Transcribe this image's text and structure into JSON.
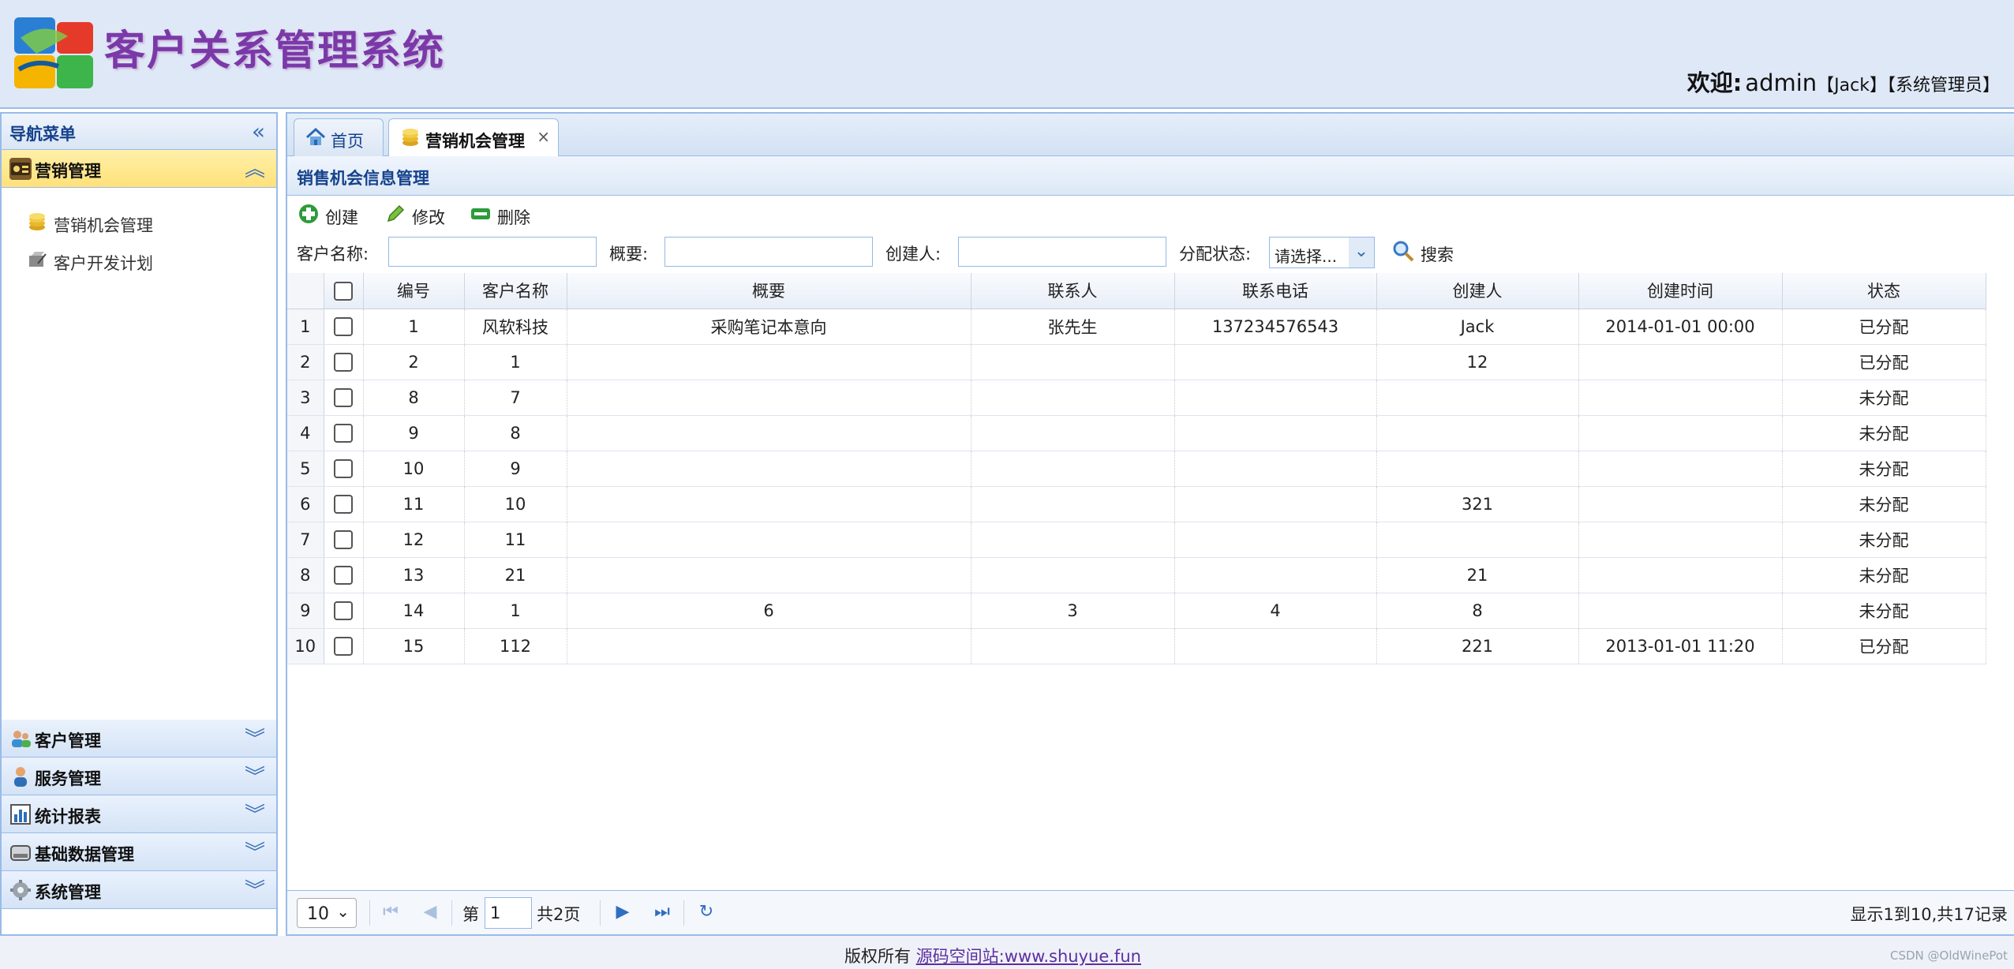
{
  "header": {
    "title": "客户关系管理系统",
    "welcome_label": "欢迎:",
    "username": "admin",
    "true_name": "【Jack】",
    "role": "【系统管理员】"
  },
  "nav": {
    "title": "导航菜单",
    "active_group": {
      "label": "营销管理",
      "icon": "marketing-icon"
    },
    "sub_items": [
      {
        "label": "营销机会管理",
        "icon": "coins-icon"
      },
      {
        "label": "客户开发计划",
        "icon": "plan-icon"
      }
    ],
    "groups": [
      {
        "label": "客户管理",
        "icon": "customers-icon"
      },
      {
        "label": "服务管理",
        "icon": "service-icon"
      },
      {
        "label": "统计报表",
        "icon": "report-icon"
      },
      {
        "label": "基础数据管理",
        "icon": "database-icon"
      },
      {
        "label": "系统管理",
        "icon": "settings-icon"
      }
    ]
  },
  "tabs": [
    {
      "label": "首页",
      "icon": "home-icon"
    },
    {
      "label": "营销机会管理",
      "icon": "coins-icon",
      "close": "×"
    }
  ],
  "panel": {
    "title": "销售机会信息管理"
  },
  "toolbar": {
    "create": "创建",
    "edit": "修改",
    "delete": "删除"
  },
  "search": {
    "customer_label": "客户名称:",
    "overview_label": "概要:",
    "creator_label": "创建人:",
    "status_label": "分配状态:",
    "status_value": "请选择...",
    "customer_value": "",
    "overview_value": "",
    "creator_value": "",
    "button": "搜索"
  },
  "grid": {
    "columns": [
      "编号",
      "客户名称",
      "概要",
      "联系人",
      "联系电话",
      "创建人",
      "创建时间",
      "状态"
    ],
    "rows": [
      [
        "1",
        "1",
        "风软科技",
        "采购笔记本意向",
        "张先生",
        "137234576543",
        "Jack",
        "2014-01-01 00:00",
        "已分配"
      ],
      [
        "2",
        "2",
        "1",
        "",
        "",
        "",
        "12",
        "",
        "已分配"
      ],
      [
        "3",
        "8",
        "7",
        "",
        "",
        "",
        "",
        "",
        "未分配"
      ],
      [
        "4",
        "9",
        "8",
        "",
        "",
        "",
        "",
        "",
        "未分配"
      ],
      [
        "5",
        "10",
        "9",
        "",
        "",
        "",
        "",
        "",
        "未分配"
      ],
      [
        "6",
        "11",
        "10",
        "",
        "",
        "",
        "321",
        "",
        "未分配"
      ],
      [
        "7",
        "12",
        "11",
        "",
        "",
        "",
        "",
        "",
        "未分配"
      ],
      [
        "8",
        "13",
        "21",
        "",
        "",
        "",
        "21",
        "",
        "未分配"
      ],
      [
        "9",
        "14",
        "1",
        "6",
        "3",
        "4",
        "8",
        "",
        "未分配"
      ],
      [
        "10",
        "15",
        "112",
        "",
        "",
        "",
        "221",
        "2013-01-01 11:20",
        "已分配"
      ]
    ]
  },
  "pager": {
    "page_size": "10",
    "page_prefix": "第",
    "page_value": "1",
    "page_total": "共2页",
    "info": "显示1到10,共17记录"
  },
  "footer": {
    "prefix": "版权所有",
    "link": "源码空间站:www.shuyue.fun"
  },
  "watermark": "CSDN @OldWinePot",
  "colors": {
    "accent": "#99bbe8",
    "title_purple": "#7b39a8",
    "active_group": "#ffe17a"
  }
}
